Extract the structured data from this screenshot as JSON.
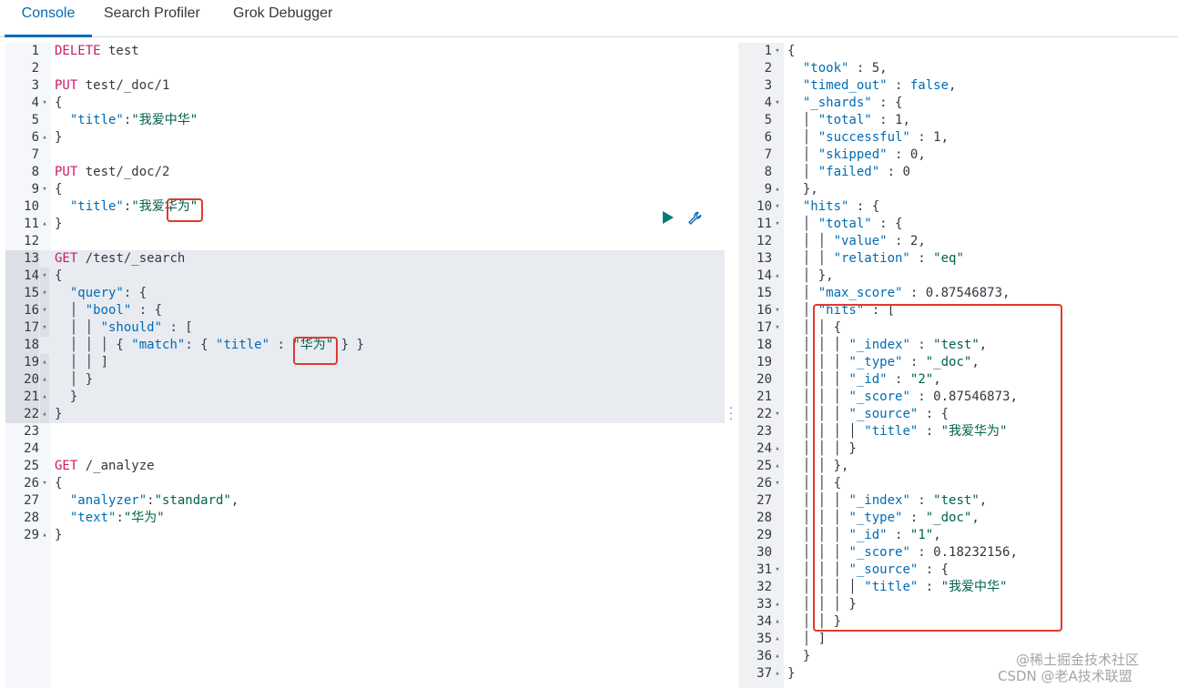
{
  "tabs": [
    {
      "label": "Console"
    },
    {
      "label": "Search Profiler"
    },
    {
      "label": "Grok Debugger"
    }
  ],
  "request_editor": {
    "lines": [
      {
        "n": "1",
        "fold": "",
        "code": [
          [
            "method",
            "DELETE"
          ],
          [
            "url",
            " test"
          ]
        ]
      },
      {
        "n": "2",
        "fold": "",
        "code": []
      },
      {
        "n": "3",
        "fold": "",
        "code": [
          [
            "method",
            "PUT"
          ],
          [
            "url",
            " test/_doc/1"
          ]
        ]
      },
      {
        "n": "4",
        "fold": "▾",
        "code": [
          [
            "punct",
            "{"
          ]
        ]
      },
      {
        "n": "5",
        "fold": "",
        "code": [
          [
            "punct",
            "  "
          ],
          [
            "key",
            "\"title\""
          ],
          [
            "punct",
            ":"
          ],
          [
            "str",
            "\"我爱中华\""
          ]
        ]
      },
      {
        "n": "6",
        "fold": "▴",
        "code": [
          [
            "punct",
            "}"
          ]
        ]
      },
      {
        "n": "7",
        "fold": "",
        "code": []
      },
      {
        "n": "8",
        "fold": "",
        "code": [
          [
            "method",
            "PUT"
          ],
          [
            "url",
            " test/_doc/2"
          ]
        ]
      },
      {
        "n": "9",
        "fold": "▾",
        "code": [
          [
            "punct",
            "{"
          ]
        ]
      },
      {
        "n": "10",
        "fold": "",
        "code": [
          [
            "punct",
            "  "
          ],
          [
            "key",
            "\"title\""
          ],
          [
            "punct",
            ":"
          ],
          [
            "str",
            "\"我爱华为\""
          ]
        ]
      },
      {
        "n": "11",
        "fold": "▴",
        "code": [
          [
            "punct",
            "}"
          ]
        ]
      },
      {
        "n": "12",
        "fold": "",
        "code": []
      },
      {
        "n": "13",
        "fold": "",
        "hl": true,
        "code": [
          [
            "method",
            "GET"
          ],
          [
            "url",
            " /test/_search"
          ]
        ]
      },
      {
        "n": "14",
        "fold": "▾",
        "hl": true,
        "code": [
          [
            "punct",
            "{"
          ]
        ]
      },
      {
        "n": "15",
        "fold": "▾",
        "hl": true,
        "code": [
          [
            "punct",
            "  "
          ],
          [
            "key",
            "\"query\""
          ],
          [
            "punct",
            ": {"
          ]
        ]
      },
      {
        "n": "16",
        "fold": "▾",
        "hl": true,
        "code": [
          [
            "punct",
            "  │ "
          ],
          [
            "key",
            "\"bool\""
          ],
          [
            "punct",
            " : {"
          ]
        ]
      },
      {
        "n": "17",
        "fold": "▾",
        "hl": true,
        "code": [
          [
            "punct",
            "  │ │ "
          ],
          [
            "key",
            "\"should\""
          ],
          [
            "punct",
            " : ["
          ]
        ]
      },
      {
        "n": "18",
        "fold": "",
        "hl": true,
        "code": [
          [
            "punct",
            "  │ │ │ { "
          ],
          [
            "key",
            "\"match\""
          ],
          [
            "punct",
            ": { "
          ],
          [
            "key",
            "\"title\""
          ],
          [
            "punct",
            " : "
          ],
          [
            "str",
            "\"华为\""
          ],
          [
            "punct",
            " } }"
          ]
        ]
      },
      {
        "n": "19",
        "fold": "▴",
        "hl": true,
        "code": [
          [
            "punct",
            "  │ │ ]"
          ]
        ]
      },
      {
        "n": "20",
        "fold": "▴",
        "hl": true,
        "code": [
          [
            "punct",
            "  │ }"
          ]
        ]
      },
      {
        "n": "21",
        "fold": "▴",
        "hl": true,
        "code": [
          [
            "punct",
            "  }"
          ]
        ]
      },
      {
        "n": "22",
        "fold": "▴",
        "hl": true,
        "code": [
          [
            "punct",
            "}"
          ]
        ]
      },
      {
        "n": "23",
        "fold": "",
        "code": []
      },
      {
        "n": "24",
        "fold": "",
        "code": []
      },
      {
        "n": "25",
        "fold": "",
        "code": [
          [
            "method",
            "GET"
          ],
          [
            "url",
            " /_analyze"
          ]
        ]
      },
      {
        "n": "26",
        "fold": "▾",
        "code": [
          [
            "punct",
            "{"
          ]
        ]
      },
      {
        "n": "27",
        "fold": "",
        "code": [
          [
            "punct",
            "  "
          ],
          [
            "key",
            "\"analyzer\""
          ],
          [
            "punct",
            ":"
          ],
          [
            "str",
            "\"standard\""
          ],
          [
            "punct",
            ","
          ]
        ]
      },
      {
        "n": "28",
        "fold": "",
        "code": [
          [
            "punct",
            "  "
          ],
          [
            "key",
            "\"text\""
          ],
          [
            "punct",
            ":"
          ],
          [
            "str",
            "\"华为\""
          ]
        ]
      },
      {
        "n": "29",
        "fold": "▴",
        "code": [
          [
            "punct",
            "}"
          ]
        ]
      }
    ]
  },
  "response_editor": {
    "lines": [
      {
        "n": "1",
        "fold": "▾",
        "code": [
          [
            "punct",
            "{"
          ]
        ]
      },
      {
        "n": "2",
        "fold": "",
        "code": [
          [
            "punct",
            "  "
          ],
          [
            "key",
            "\"took\""
          ],
          [
            "punct",
            " : "
          ],
          [
            "num",
            "5"
          ],
          [
            "punct",
            ","
          ]
        ]
      },
      {
        "n": "3",
        "fold": "",
        "code": [
          [
            "punct",
            "  "
          ],
          [
            "key",
            "\"timed_out\""
          ],
          [
            "punct",
            " : "
          ],
          [
            "kw",
            "false"
          ],
          [
            "punct",
            ","
          ]
        ]
      },
      {
        "n": "4",
        "fold": "▾",
        "code": [
          [
            "punct",
            "  "
          ],
          [
            "key",
            "\"_shards\""
          ],
          [
            "punct",
            " : {"
          ]
        ]
      },
      {
        "n": "5",
        "fold": "",
        "code": [
          [
            "punct",
            "  │ "
          ],
          [
            "key",
            "\"total\""
          ],
          [
            "punct",
            " : "
          ],
          [
            "num",
            "1"
          ],
          [
            "punct",
            ","
          ]
        ]
      },
      {
        "n": "6",
        "fold": "",
        "code": [
          [
            "punct",
            "  │ "
          ],
          [
            "key",
            "\"successful\""
          ],
          [
            "punct",
            " : "
          ],
          [
            "num",
            "1"
          ],
          [
            "punct",
            ","
          ]
        ]
      },
      {
        "n": "7",
        "fold": "",
        "code": [
          [
            "punct",
            "  │ "
          ],
          [
            "key",
            "\"skipped\""
          ],
          [
            "punct",
            " : "
          ],
          [
            "num",
            "0"
          ],
          [
            "punct",
            ","
          ]
        ]
      },
      {
        "n": "8",
        "fold": "",
        "code": [
          [
            "punct",
            "  │ "
          ],
          [
            "key",
            "\"failed\""
          ],
          [
            "punct",
            " : "
          ],
          [
            "num",
            "0"
          ]
        ]
      },
      {
        "n": "9",
        "fold": "▴",
        "code": [
          [
            "punct",
            "  },"
          ]
        ]
      },
      {
        "n": "10",
        "fold": "▾",
        "code": [
          [
            "punct",
            "  "
          ],
          [
            "key",
            "\"hits\""
          ],
          [
            "punct",
            " : {"
          ]
        ]
      },
      {
        "n": "11",
        "fold": "▾",
        "code": [
          [
            "punct",
            "  │ "
          ],
          [
            "key",
            "\"total\""
          ],
          [
            "punct",
            " : {"
          ]
        ]
      },
      {
        "n": "12",
        "fold": "",
        "code": [
          [
            "punct",
            "  │ │ "
          ],
          [
            "key",
            "\"value\""
          ],
          [
            "punct",
            " : "
          ],
          [
            "num",
            "2"
          ],
          [
            "punct",
            ","
          ]
        ]
      },
      {
        "n": "13",
        "fold": "",
        "code": [
          [
            "punct",
            "  │ │ "
          ],
          [
            "key",
            "\"relation\""
          ],
          [
            "punct",
            " : "
          ],
          [
            "str",
            "\"eq\""
          ]
        ]
      },
      {
        "n": "14",
        "fold": "▴",
        "code": [
          [
            "punct",
            "  │ },"
          ]
        ]
      },
      {
        "n": "15",
        "fold": "",
        "code": [
          [
            "punct",
            "  │ "
          ],
          [
            "key",
            "\"max_score\""
          ],
          [
            "punct",
            " : "
          ],
          [
            "num",
            "0.87546873"
          ],
          [
            "punct",
            ","
          ]
        ]
      },
      {
        "n": "16",
        "fold": "▾",
        "code": [
          [
            "punct",
            "  │ "
          ],
          [
            "key",
            "\"hits\""
          ],
          [
            "punct",
            " : ["
          ]
        ]
      },
      {
        "n": "17",
        "fold": "▾",
        "code": [
          [
            "punct",
            "  │ │ {"
          ]
        ]
      },
      {
        "n": "18",
        "fold": "",
        "code": [
          [
            "punct",
            "  │ │ │ "
          ],
          [
            "key",
            "\"_index\""
          ],
          [
            "punct",
            " : "
          ],
          [
            "str",
            "\"test\""
          ],
          [
            "punct",
            ","
          ]
        ]
      },
      {
        "n": "19",
        "fold": "",
        "code": [
          [
            "punct",
            "  │ │ │ "
          ],
          [
            "key",
            "\"_type\""
          ],
          [
            "punct",
            " : "
          ],
          [
            "str",
            "\"_doc\""
          ],
          [
            "punct",
            ","
          ]
        ]
      },
      {
        "n": "20",
        "fold": "",
        "code": [
          [
            "punct",
            "  │ │ │ "
          ],
          [
            "key",
            "\"_id\""
          ],
          [
            "punct",
            " : "
          ],
          [
            "str",
            "\"2\""
          ],
          [
            "punct",
            ","
          ]
        ]
      },
      {
        "n": "21",
        "fold": "",
        "code": [
          [
            "punct",
            "  │ │ │ "
          ],
          [
            "key",
            "\"_score\""
          ],
          [
            "punct",
            " : "
          ],
          [
            "num",
            "0.87546873"
          ],
          [
            "punct",
            ","
          ]
        ]
      },
      {
        "n": "22",
        "fold": "▾",
        "code": [
          [
            "punct",
            "  │ │ │ "
          ],
          [
            "key",
            "\"_source\""
          ],
          [
            "punct",
            " : {"
          ]
        ]
      },
      {
        "n": "23",
        "fold": "",
        "code": [
          [
            "punct",
            "  │ │ │ │ "
          ],
          [
            "key",
            "\"title\""
          ],
          [
            "punct",
            " : "
          ],
          [
            "str",
            "\"我爱华为\""
          ]
        ]
      },
      {
        "n": "24",
        "fold": "▴",
        "code": [
          [
            "punct",
            "  │ │ │ }"
          ]
        ]
      },
      {
        "n": "25",
        "fold": "▴",
        "code": [
          [
            "punct",
            "  │ │ },"
          ]
        ]
      },
      {
        "n": "26",
        "fold": "▾",
        "code": [
          [
            "punct",
            "  │ │ {"
          ]
        ]
      },
      {
        "n": "27",
        "fold": "",
        "code": [
          [
            "punct",
            "  │ │ │ "
          ],
          [
            "key",
            "\"_index\""
          ],
          [
            "punct",
            " : "
          ],
          [
            "str",
            "\"test\""
          ],
          [
            "punct",
            ","
          ]
        ]
      },
      {
        "n": "28",
        "fold": "",
        "code": [
          [
            "punct",
            "  │ │ │ "
          ],
          [
            "key",
            "\"_type\""
          ],
          [
            "punct",
            " : "
          ],
          [
            "str",
            "\"_doc\""
          ],
          [
            "punct",
            ","
          ]
        ]
      },
      {
        "n": "29",
        "fold": "",
        "code": [
          [
            "punct",
            "  │ │ │ "
          ],
          [
            "key",
            "\"_id\""
          ],
          [
            "punct",
            " : "
          ],
          [
            "str",
            "\"1\""
          ],
          [
            "punct",
            ","
          ]
        ]
      },
      {
        "n": "30",
        "fold": "",
        "code": [
          [
            "punct",
            "  │ │ │ "
          ],
          [
            "key",
            "\"_score\""
          ],
          [
            "punct",
            " : "
          ],
          [
            "num",
            "0.18232156"
          ],
          [
            "punct",
            ","
          ]
        ]
      },
      {
        "n": "31",
        "fold": "▾",
        "code": [
          [
            "punct",
            "  │ │ │ "
          ],
          [
            "key",
            "\"_source\""
          ],
          [
            "punct",
            " : {"
          ]
        ]
      },
      {
        "n": "32",
        "fold": "",
        "code": [
          [
            "punct",
            "  │ │ │ │ "
          ],
          [
            "key",
            "\"title\""
          ],
          [
            "punct",
            " : "
          ],
          [
            "str",
            "\"我爱中华\""
          ]
        ]
      },
      {
        "n": "33",
        "fold": "▴",
        "code": [
          [
            "punct",
            "  │ │ │ }"
          ]
        ]
      },
      {
        "n": "34",
        "fold": "▴",
        "code": [
          [
            "punct",
            "  │ │ }"
          ]
        ]
      },
      {
        "n": "35",
        "fold": "▴",
        "code": [
          [
            "punct",
            "  │ ]"
          ]
        ]
      },
      {
        "n": "36",
        "fold": "▴",
        "code": [
          [
            "punct",
            "  }"
          ]
        ]
      },
      {
        "n": "37",
        "fold": "▴",
        "code": [
          [
            "punct",
            "}"
          ]
        ]
      }
    ]
  },
  "actions": {
    "run_icon": "play-icon",
    "settings_icon": "wrench-icon"
  },
  "watermark": {
    "line1": "@稀土掘金技术社区",
    "line2": "CSDN @老A技术联盟"
  }
}
